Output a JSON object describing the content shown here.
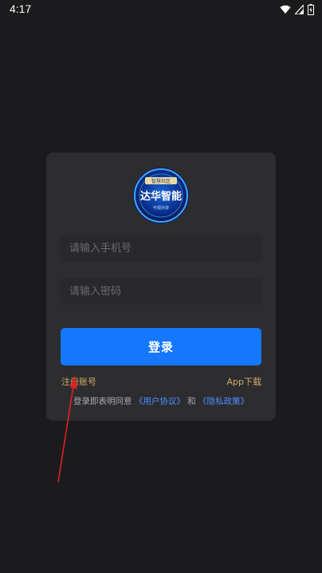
{
  "status_bar": {
    "time": "4:17",
    "icons": [
      "wifi-icon",
      "signal-icon",
      "battery-icon"
    ]
  },
  "logo": {
    "brand_text": "达华智能",
    "banner_text": "智慧社区",
    "sub_text": "可视对讲"
  },
  "login_form": {
    "phone_placeholder": "请输入手机号",
    "password_placeholder": "请输入密码",
    "login_button": "登录",
    "register_link": "注册账号",
    "download_link": "App下载"
  },
  "agreement": {
    "prefix": "登录即表明同意",
    "user_agreement": "《用户协议》",
    "conjunction": "和",
    "privacy_policy": "《隐私政策》"
  },
  "colors": {
    "background": "#1b1b1d",
    "card": "#2d2d30",
    "primary_button": "#1677ff",
    "gold_link": "#d3aa6a",
    "blue_link": "#4d8dff",
    "annotation_arrow": "#e02020"
  }
}
